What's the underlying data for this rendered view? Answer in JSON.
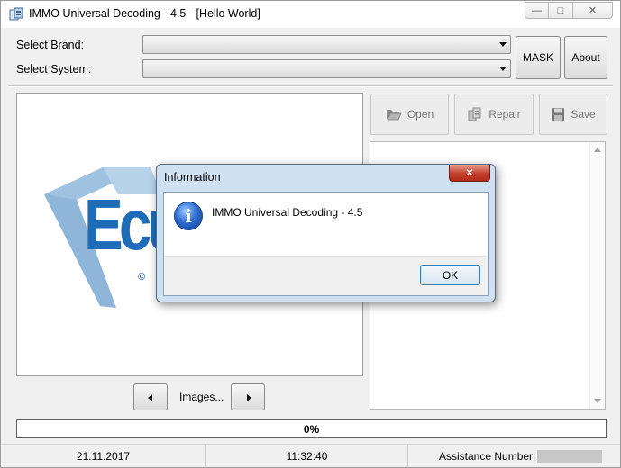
{
  "window": {
    "title": "IMMO Universal Decoding - 4.5 - [Hello World]",
    "controls": {
      "minimize": "—",
      "maximize": "□",
      "close": "✕"
    }
  },
  "selectors": {
    "brand_label": "Select Brand:",
    "brand_value": "",
    "system_label": "Select System:",
    "system_value": ""
  },
  "buttons": {
    "mask": "MASK",
    "about": "About",
    "open": "Open",
    "repair": "Repair",
    "save": "Save"
  },
  "image_panel": {
    "logo_text": "Ecu",
    "copyright": "©",
    "nav_label": "Images..."
  },
  "progress": {
    "text": "0%",
    "value": 0
  },
  "status": {
    "date": "21.11.2017",
    "time": "11:32:40",
    "assistance_label": "Assistance Number:"
  },
  "dialog": {
    "title": "Information",
    "close": "✕",
    "message": "IMMO Universal Decoding - 4.5",
    "icon_glyph": "i",
    "ok": "OK"
  },
  "colors": {
    "dialog_frame": "#cfe0f1",
    "close_red": "#c3402d",
    "logo_blue": "#1e6bb8",
    "logo_light": "#9ec2df"
  }
}
